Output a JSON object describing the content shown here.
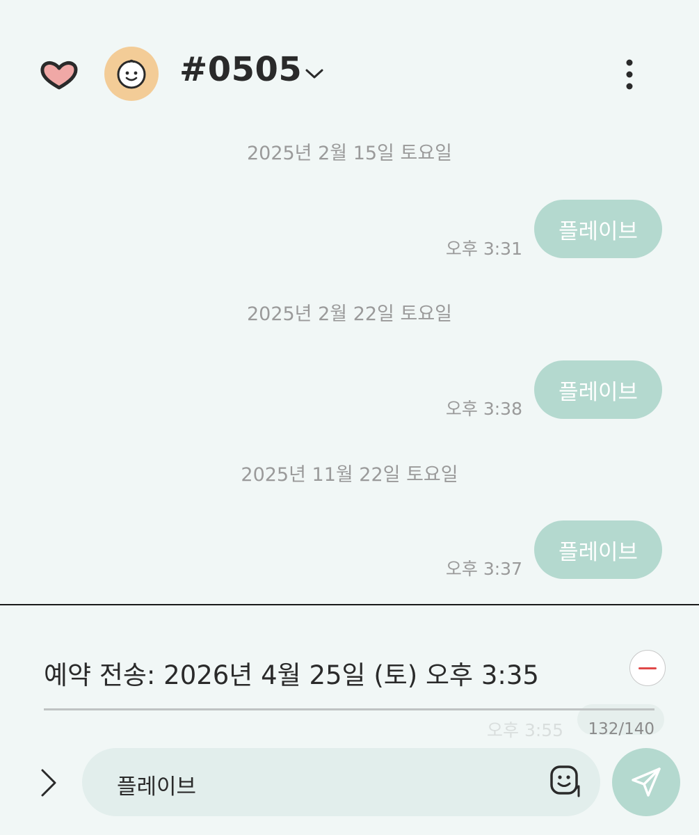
{
  "header": {
    "title": "#0505",
    "icons": {
      "favorite": "heart-icon",
      "avatar": "smiley-face-avatar",
      "dropdown": "chevron-down-icon",
      "menu": "more-vertical-icon"
    }
  },
  "messages": [
    {
      "date": "2025년 2월 15일 토요일",
      "text": "플레이브",
      "time": "오후 3:31"
    },
    {
      "date": "2025년 2월 22일 토요일",
      "text": "플레이브",
      "time": "오후 3:38"
    },
    {
      "date": "2025년 11월 22일 토요일",
      "text": "플레이브",
      "time": "오후 3:37"
    }
  ],
  "composer": {
    "schedule_label": "예약 전송: 2026년 4월 25일 (토) 오후 3:35",
    "ghost_time": "오후 3:55",
    "char_count": "132/140",
    "input_value": "플레이브",
    "icons": {
      "expand": "chevron-right-icon",
      "emoji": "emoji-icon",
      "send": "send-icon",
      "remove": "remove-schedule-icon"
    }
  },
  "colors": {
    "background": "#f1f7f6",
    "bubble": "#b4d9cf",
    "avatar": "#f3cc97",
    "remove": "#e04848"
  }
}
